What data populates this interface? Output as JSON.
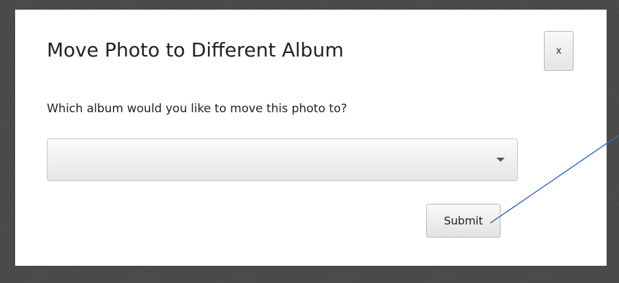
{
  "dialog": {
    "title": "Move Photo to Different Album",
    "close_label": "x",
    "prompt": "Which album would you like to move this photo to?",
    "album_select": {
      "selected_value": ""
    },
    "submit_label": "Submit"
  },
  "colors": {
    "background": "#4a4a4a",
    "dialog_background": "#ffffff",
    "annotation_line": "#3b6fb0"
  }
}
